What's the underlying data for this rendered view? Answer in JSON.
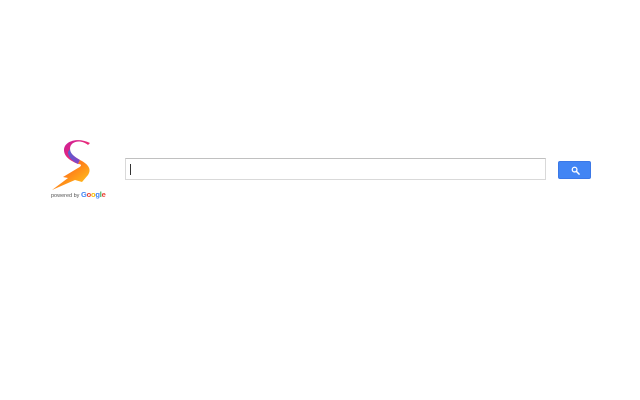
{
  "logo": {
    "icon_name": "s-lightning-bolt-logo-icon",
    "powered_by_text": "powered by ",
    "google_letters": [
      {
        "char": "G",
        "color": "#4285F4"
      },
      {
        "char": "o",
        "color": "#EA4335"
      },
      {
        "char": "o",
        "color": "#FBBC05"
      },
      {
        "char": "g",
        "color": "#4285F4"
      },
      {
        "char": "l",
        "color": "#34A853"
      },
      {
        "char": "e",
        "color": "#EA4335"
      }
    ]
  },
  "search": {
    "value": "",
    "placeholder": "",
    "button_icon": "magnifier-icon",
    "button_color": "#4285F4"
  }
}
